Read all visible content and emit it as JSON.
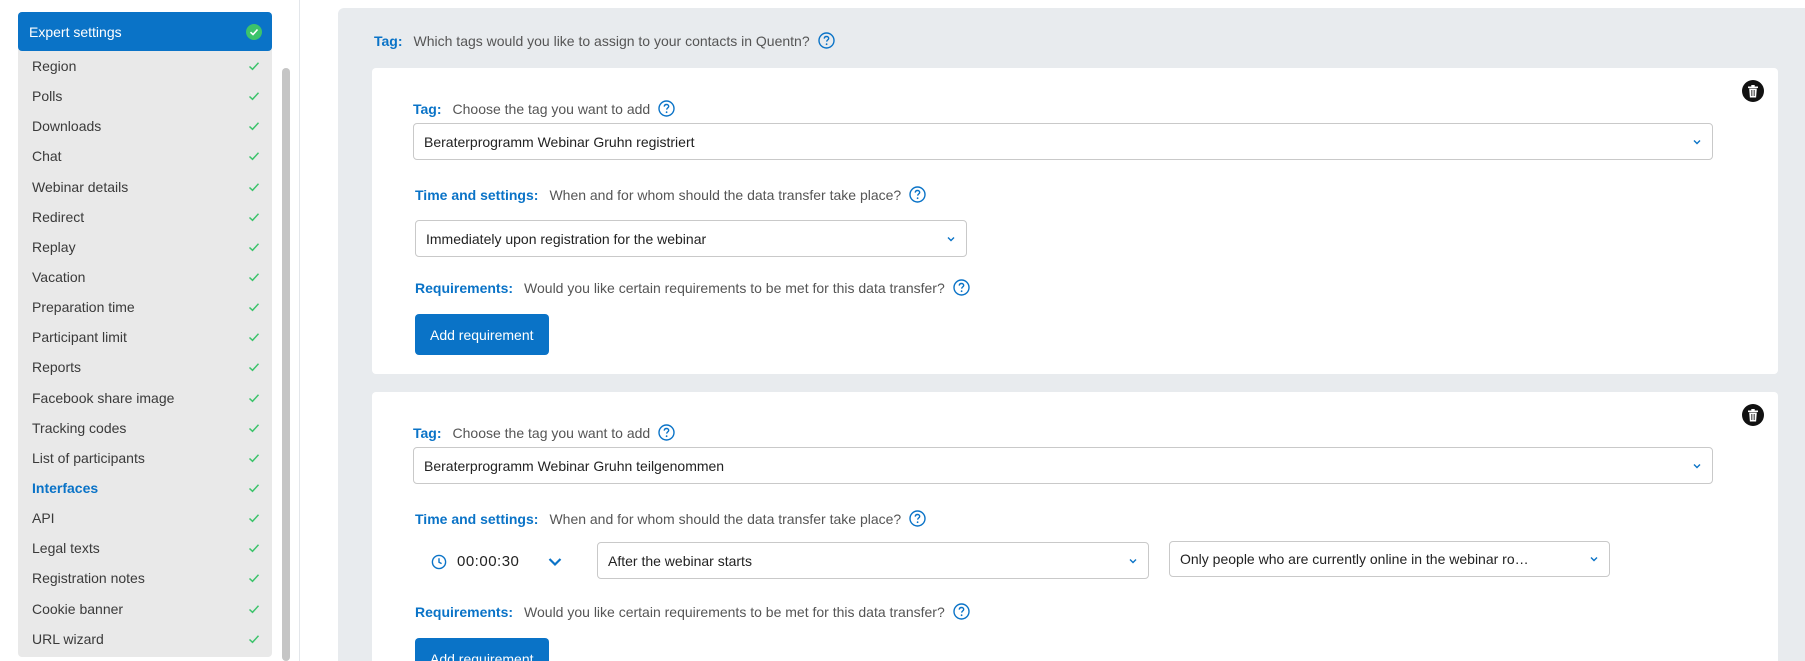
{
  "sidebar": {
    "header": "Expert settings",
    "items": [
      {
        "label": "Region"
      },
      {
        "label": "Polls"
      },
      {
        "label": "Downloads"
      },
      {
        "label": "Chat"
      },
      {
        "label": "Webinar details"
      },
      {
        "label": "Redirect"
      },
      {
        "label": "Replay"
      },
      {
        "label": "Vacation"
      },
      {
        "label": "Preparation time"
      },
      {
        "label": "Participant limit"
      },
      {
        "label": "Reports"
      },
      {
        "label": "Facebook share image"
      },
      {
        "label": "Tracking codes"
      },
      {
        "label": "List of participants"
      },
      {
        "label": "Interfaces",
        "active": true
      },
      {
        "label": "API"
      },
      {
        "label": "Legal texts"
      },
      {
        "label": "Registration notes"
      },
      {
        "label": "Cookie banner"
      },
      {
        "label": "URL wizard"
      }
    ]
  },
  "main": {
    "tag_label": "Tag:",
    "tag_question": "Which tags would you like to assign to your contacts in Quentn?",
    "cards": [
      {
        "tag_label": "Tag:",
        "tag_desc": "Choose the tag you want to add",
        "tag_value": "Beraterprogramm Webinar Gruhn registriert",
        "time_label": "Time and settings:",
        "time_desc": "When and for whom should the data transfer take place?",
        "timing_value": "Immediately upon registration for the webinar",
        "req_label": "Requirements:",
        "req_desc": "Would you like certain requirements to be met for this data transfer?",
        "button": "Add requirement"
      },
      {
        "tag_label": "Tag:",
        "tag_desc": "Choose the tag you want to add",
        "tag_value": "Beraterprogramm Webinar Gruhn teilgenommen",
        "time_label": "Time and settings:",
        "time_desc": "When and for whom should the data transfer take place?",
        "time_offset": "00:00:30",
        "timing_value": "After the webinar starts",
        "audience_value": "Only people who are currently online in the webinar ro…",
        "req_label": "Requirements:",
        "req_desc": "Would you like certain requirements to be met for this data transfer?",
        "button": "Add requirement"
      }
    ]
  },
  "colors": {
    "accent": "#0a73c7",
    "success": "#3cc36b",
    "panel_bg": "#e8ebee",
    "sidebar_bg": "#e9e9e9"
  }
}
